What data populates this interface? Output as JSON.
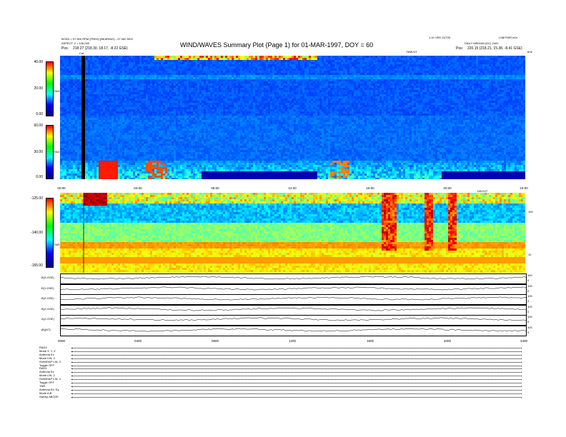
{
  "header": {
    "left_line1": "BOSD = 97.500 RPM (FRED) (BEARING) - 37.052 DEG",
    "left_line2": "ASPECT: 2 = 126.000",
    "left_pos_label": "Pos:",
    "left_pos_value": "218.27 (218.30, 18.17, -8.22 GSE)",
    "title": "WIND/WAVES Summary Plot (Page 1) for 01-MAR-1997, DOY = 60",
    "right_line1": "1.10 VED 2UT00",
    "right_line1b": "L0B/T00R.n0n",
    "right_line2": "DAILY MEDIAN (DC) 2n02",
    "right_pos_label": "Pos:",
    "right_pos_value": "220.15 (218.21, 15.38, -8.41 GSE)",
    "left_top_marker": "Cal",
    "time_label_top": "TIME/UT",
    "right_top_marker": "kHz",
    "time_label_mid": "DAY/UT"
  },
  "colors": {
    "spectrogram_bg": "#0a2fd8",
    "cbar_stops": [
      "#000080",
      "#0000ff",
      "#00ffff",
      "#00ff00",
      "#ffff00",
      "#ff0000"
    ]
  },
  "chart_data": [
    {
      "type": "heatmap",
      "name_label": "RAD2",
      "cbar_ticks": [
        "40.00",
        "20.00",
        "0.00"
      ],
      "zlim": [
        0,
        40
      ]
    },
    {
      "type": "heatmap",
      "name_label": "RAD1",
      "cbar_ticks": [
        "60.00",
        "30.00",
        "0.00"
      ],
      "zlim": [
        0,
        60
      ]
    },
    {
      "type": "heatmap",
      "name_label": "TNR",
      "cbar_ticks": [
        "-125.00",
        "-140.00",
        "-155.00"
      ],
      "zlim": [
        -155,
        -125
      ],
      "yaxis_right_ticks": [
        "100",
        "10"
      ]
    },
    {
      "type": "line",
      "traces": [
        "B(X-GSE)",
        "B(Y-GSE)",
        "B(Z-GSE)",
        "B(X-GSE)",
        "A(X-GSE)",
        "|B|(NT)"
      ],
      "right_ticks": [
        [
          "100",
          "0"
        ],
        [
          "100",
          "0"
        ],
        [
          "100",
          "0"
        ],
        [
          "100",
          "0"
        ],
        [
          "100",
          "0"
        ],
        [
          "100",
          "0"
        ]
      ]
    }
  ],
  "xaxis": {
    "ticks_top": [
      "00:00",
      "04:00",
      "08:00",
      "12:00",
      "16:00",
      "20:00",
      "24:00"
    ],
    "ticks_bottom": [
      "0000",
      "0400",
      "0800",
      "1200",
      "1600",
      "2000",
      "2400"
    ]
  },
  "footer": {
    "lines": [
      "RAD2",
      "Mode        X, Y, Z",
      "Antenna      Ex",
      "Mode      LIN, 2",
      "SUM/DAP  LIN, 2",
      "Toggle      OFF",
      "RAD1",
      "Antenna      Ex",
      "Mode      LIN, 2",
      "SUM/DAP  LIN, 2",
      "Toggle      OFF",
      "TNR",
      "Antenna    Ex, Ey",
      "Mode          A,B",
      "Sweep    ABCDE"
    ]
  }
}
